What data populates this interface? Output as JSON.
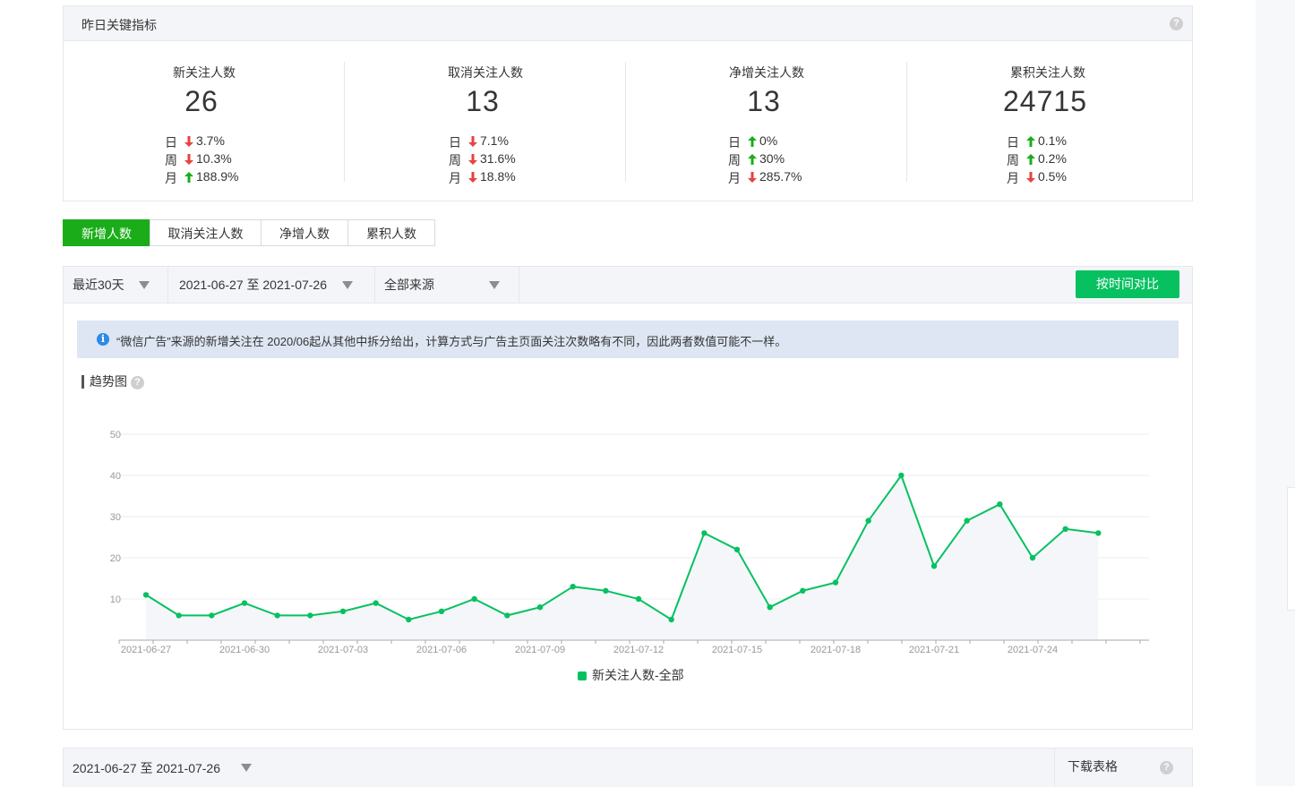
{
  "metrics": {
    "title": "昨日关键指标",
    "items": [
      {
        "title": "新关注人数",
        "value": "26",
        "rows": [
          {
            "label": "日",
            "dir": "down",
            "pct": "3.7%"
          },
          {
            "label": "周",
            "dir": "down",
            "pct": "10.3%"
          },
          {
            "label": "月",
            "dir": "up",
            "pct": "188.9%"
          }
        ]
      },
      {
        "title": "取消关注人数",
        "value": "13",
        "rows": [
          {
            "label": "日",
            "dir": "down",
            "pct": "7.1%"
          },
          {
            "label": "周",
            "dir": "down",
            "pct": "31.6%"
          },
          {
            "label": "月",
            "dir": "down",
            "pct": "18.8%"
          }
        ]
      },
      {
        "title": "净增关注人数",
        "value": "13",
        "rows": [
          {
            "label": "日",
            "dir": "up",
            "pct": "0%"
          },
          {
            "label": "周",
            "dir": "up",
            "pct": "30%"
          },
          {
            "label": "月",
            "dir": "down",
            "pct": "285.7%"
          }
        ]
      },
      {
        "title": "累积关注人数",
        "value": "24715",
        "rows": [
          {
            "label": "日",
            "dir": "up",
            "pct": "0.1%"
          },
          {
            "label": "周",
            "dir": "up",
            "pct": "0.2%"
          },
          {
            "label": "月",
            "dir": "down",
            "pct": "0.5%"
          }
        ]
      }
    ]
  },
  "tabs": [
    {
      "label": "新增人数",
      "active": true
    },
    {
      "label": "取消关注人数",
      "active": false
    },
    {
      "label": "净增人数",
      "active": false
    },
    {
      "label": "累积人数",
      "active": false
    }
  ],
  "toolbar": {
    "period": "最近30天",
    "date_range": "2021-06-27 至 2021-07-26",
    "source": "全部来源",
    "compare_button": "按时间对比"
  },
  "notice": "“微信广告”来源的新增关注在 2020/06起从其他中拆分给出，计算方式与广告主页面关注次数略有不同，因此两者数值可能不一样。",
  "trend_title": "趋势图",
  "chart_data": {
    "type": "area",
    "x": [
      "2021-06-27",
      "2021-06-28",
      "2021-06-29",
      "2021-06-30",
      "2021-07-01",
      "2021-07-02",
      "2021-07-03",
      "2021-07-04",
      "2021-07-05",
      "2021-07-06",
      "2021-07-07",
      "2021-07-08",
      "2021-07-09",
      "2021-07-10",
      "2021-07-11",
      "2021-07-12",
      "2021-07-13",
      "2021-07-14",
      "2021-07-15",
      "2021-07-16",
      "2021-07-17",
      "2021-07-18",
      "2021-07-19",
      "2021-07-20",
      "2021-07-21",
      "2021-07-22",
      "2021-07-23",
      "2021-07-24",
      "2021-07-25",
      "2021-07-26"
    ],
    "tick_labels": [
      "2021-06-27",
      "2021-06-30",
      "2021-07-03",
      "2021-07-06",
      "2021-07-09",
      "2021-07-12",
      "2021-07-15",
      "2021-07-18",
      "2021-07-21",
      "2021-07-24"
    ],
    "series": [
      {
        "name": "新关注人数-全部",
        "color": "#07c160",
        "values": [
          11,
          6,
          6,
          9,
          6,
          6,
          7,
          9,
          5,
          7,
          10,
          6,
          8,
          13,
          12,
          10,
          5,
          26,
          22,
          8,
          12,
          14,
          29,
          40,
          18,
          29,
          33,
          20,
          27,
          26
        ]
      }
    ],
    "yticks": [
      10,
      20,
      30,
      40,
      50
    ],
    "ylim": [
      0,
      50
    ],
    "grid": true,
    "legend": "bottom-center"
  },
  "bottom": {
    "date_range": "2021-06-27 至 2021-07-26",
    "download": "下载表格"
  },
  "colors": {
    "green": "#07c160",
    "up": "#1aad19",
    "down": "#e64340"
  }
}
